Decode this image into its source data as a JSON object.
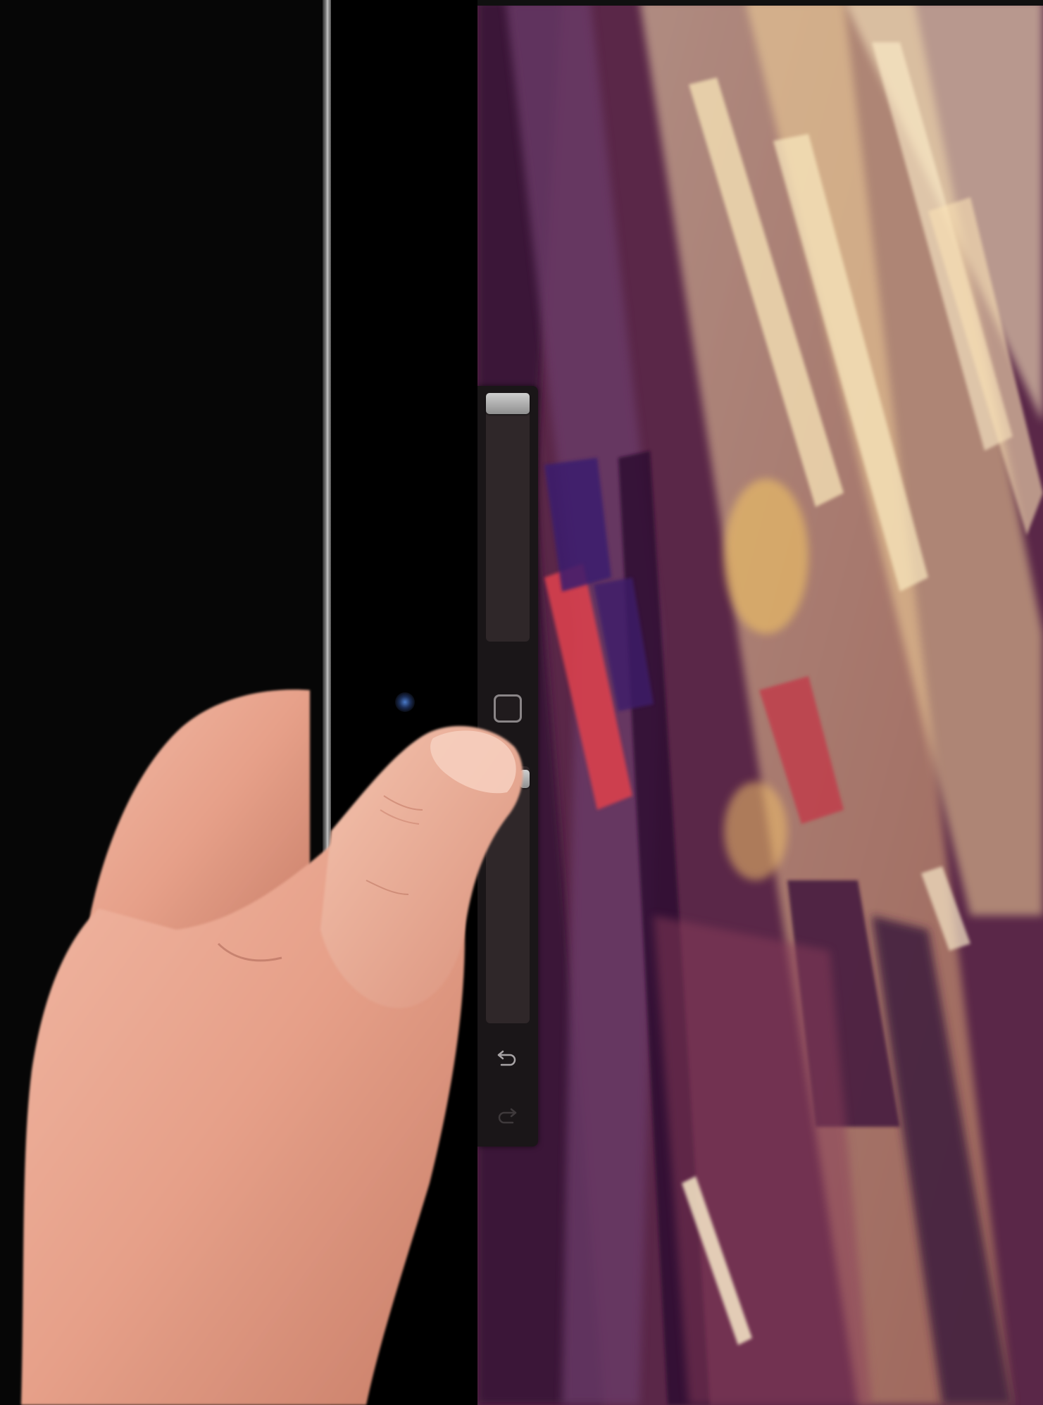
{
  "app": {
    "name": "",
    "accent_color": "#b6b6b6"
  },
  "sidebar": {
    "brush_size_slider": {
      "value_fraction": 0.0
    },
    "modify_button": {
      "icon": "square-outline-icon"
    },
    "opacity_slider": {
      "value_fraction": 1.0
    },
    "undo_button": {
      "icon": "undo-arrow-icon"
    },
    "redo_button": {
      "icon": "redo-arrow-icon",
      "enabled": false
    }
  },
  "canvas": {
    "palette": [
      "#3c1b3f",
      "#5e2a4e",
      "#b26a55",
      "#e9b77d",
      "#f3d39a",
      "#d9414d",
      "#3d1f6b",
      "#2a1230"
    ]
  }
}
